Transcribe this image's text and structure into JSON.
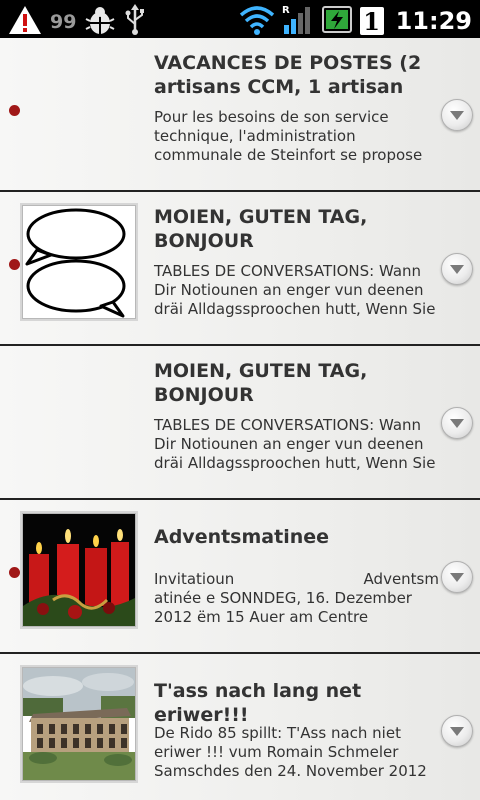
{
  "status_bar": {
    "notification_count": "99",
    "battery_badge": "1",
    "time": "11:29",
    "icons": [
      "warning-icon",
      "debug-bug-icon",
      "usb-icon",
      "wifi-icon",
      "roaming-icon",
      "signal-icon",
      "battery-charging-icon"
    ]
  },
  "list": {
    "items": [
      {
        "title_lines": [
          "VACANCES DE POSTES (2",
          "artisans CCM, 1 artisan"
        ],
        "desc_lines": [
          "Pour les besoins de son service",
          "technique, l'administration",
          "communale de Steinfort se propose"
        ],
        "unread": true,
        "thumbnail": "none"
      },
      {
        "title_lines": [
          "MOIEN, GUTEN TAG,",
          "BONJOUR"
        ],
        "desc_lines": [
          "TABLES DE CONVERSATIONS: Wann",
          "Dir Notiounen an enger vun deenen",
          "dräi Alldagssproochen hutt, Wenn Sie"
        ],
        "unread": true,
        "thumbnail": "speech-bubbles-image"
      },
      {
        "title_lines": [
          "MOIEN, GUTEN TAG,",
          "BONJOUR"
        ],
        "desc_lines": [
          "TABLES DE CONVERSATIONS: Wann",
          "Dir Notiounen an enger vun deenen",
          "dräi Alldagssproochen hutt, Wenn Sie"
        ],
        "unread": false,
        "thumbnail": "none"
      },
      {
        "title_lines": [
          "Adventsmatinee"
        ],
        "desc_first_left": "Invitatioun",
        "desc_first_right": "Adventsm",
        "desc_lines": [
          "atinée e SONNDEG, 16. Dezember",
          "2012 ëm 15 Auer am Centre"
        ],
        "unread": true,
        "thumbnail": "advent-candles-image"
      },
      {
        "title_lines": [
          "T'ass nach lang net eriwer!!!"
        ],
        "desc_lines": [
          "De Rido 85 spillt: T'Ass nach niet",
          "eriwer !!! vum Romain Schmeler",
          "Samschdes den 24. November 2012"
        ],
        "unread": false,
        "thumbnail": "building-photo-image"
      }
    ]
  },
  "colors": {
    "unread_dot": "#a01818",
    "row_divider": "#222222",
    "text": "#333333"
  }
}
